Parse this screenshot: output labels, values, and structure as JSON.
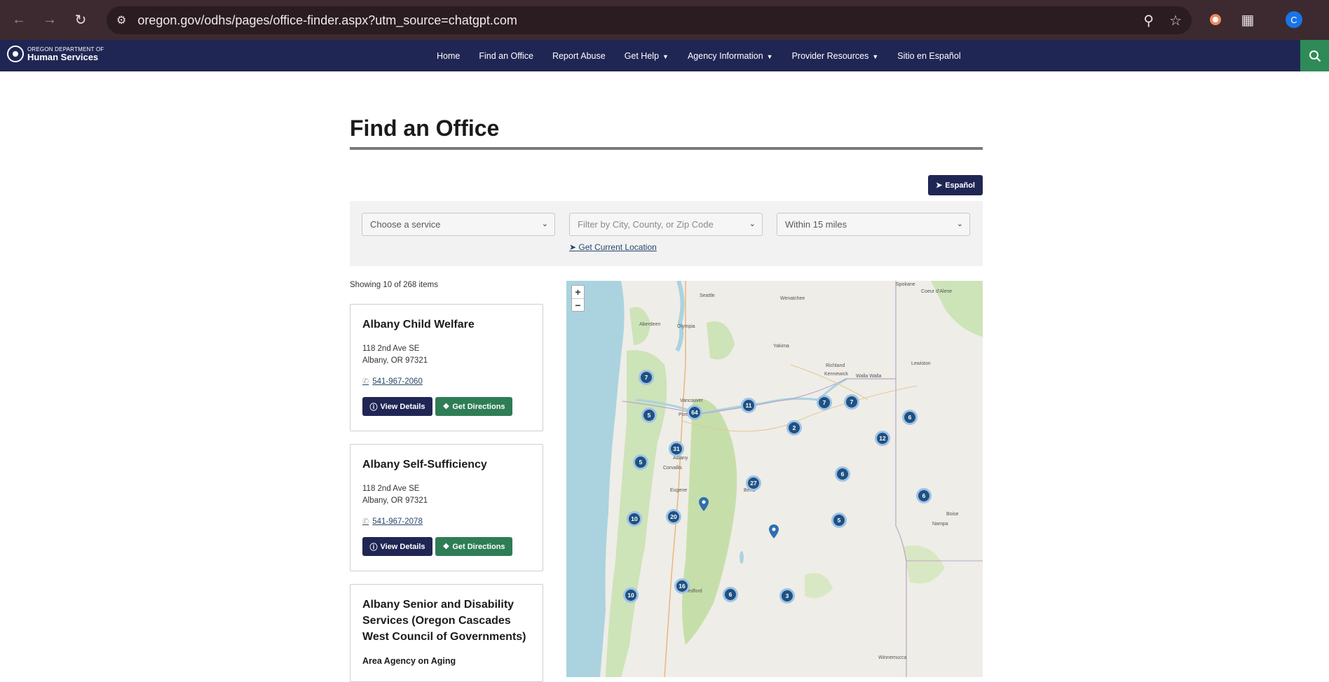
{
  "browser": {
    "url": "oregon.gov/odhs/pages/office-finder.aspx?utm_source=chatgpt.com",
    "profile_initial": "C",
    "icons": [
      "back-icon",
      "forward-icon",
      "reload-icon",
      "site-info-icon",
      "zoom-icon",
      "star-icon",
      "extension-icon",
      "puzzle-icon"
    ]
  },
  "site": {
    "logo_line1": "OREGON DEPARTMENT OF",
    "logo_line2": "Human Services",
    "nav": [
      {
        "label": "Home",
        "dropdown": false
      },
      {
        "label": "Find an Office",
        "dropdown": false
      },
      {
        "label": "Report Abuse",
        "dropdown": false
      },
      {
        "label": "Get Help",
        "dropdown": true
      },
      {
        "label": "Agency Information",
        "dropdown": true
      },
      {
        "label": "Provider Resources",
        "dropdown": true
      },
      {
        "label": "Sitio en Español",
        "dropdown": false
      }
    ],
    "caret": "▼"
  },
  "page": {
    "title": "Find an Office",
    "espanol_label": "Español",
    "filters": {
      "service_value": "Choose a service",
      "location_placeholder": "Filter by City, County, or Zip Code",
      "distance_value": "Within 15 miles",
      "current_location_label": "Get Current Location"
    },
    "showing": "Showing 10 of 268 items",
    "offices": [
      {
        "name": "Albany Child Welfare",
        "address1": "118 2nd Ave SE",
        "address2": "Albany, OR 97321",
        "phone": "541-967-2060",
        "details_label": "View Details",
        "directions_label": "Get Directions"
      },
      {
        "name": "Albany Self-Sufficiency",
        "address1": "118 2nd Ave SE",
        "address2": "Albany, OR 97321",
        "phone": "541-967-2078",
        "details_label": "View Details",
        "directions_label": "Get Directions"
      },
      {
        "name": "Albany Senior and Disability Services (Oregon Cascades West Council of Governments)",
        "subtitle": "Area Agency on Aging"
      }
    ],
    "map": {
      "zoom_in": "+",
      "zoom_out": "−",
      "clusters": [
        "7",
        "5",
        "64",
        "11",
        "7",
        "7",
        "6",
        "2",
        "12",
        "31",
        "5",
        "27",
        "6",
        "6",
        "10",
        "20",
        "5",
        "16",
        "10",
        "6",
        "3"
      ],
      "place_labels": [
        "Seattle",
        "Olympia",
        "Aberdeen",
        "Wenatchee",
        "Spokane",
        "Coeur d'Alene",
        "Yakima",
        "Richland",
        "Kennewick",
        "Walla Walla",
        "Lewiston",
        "Vancouver",
        "Portland",
        "Albany",
        "Corvallis",
        "Eugene",
        "Bend",
        "Boise",
        "Nampa",
        "Medford",
        "Winnemucca"
      ]
    }
  }
}
